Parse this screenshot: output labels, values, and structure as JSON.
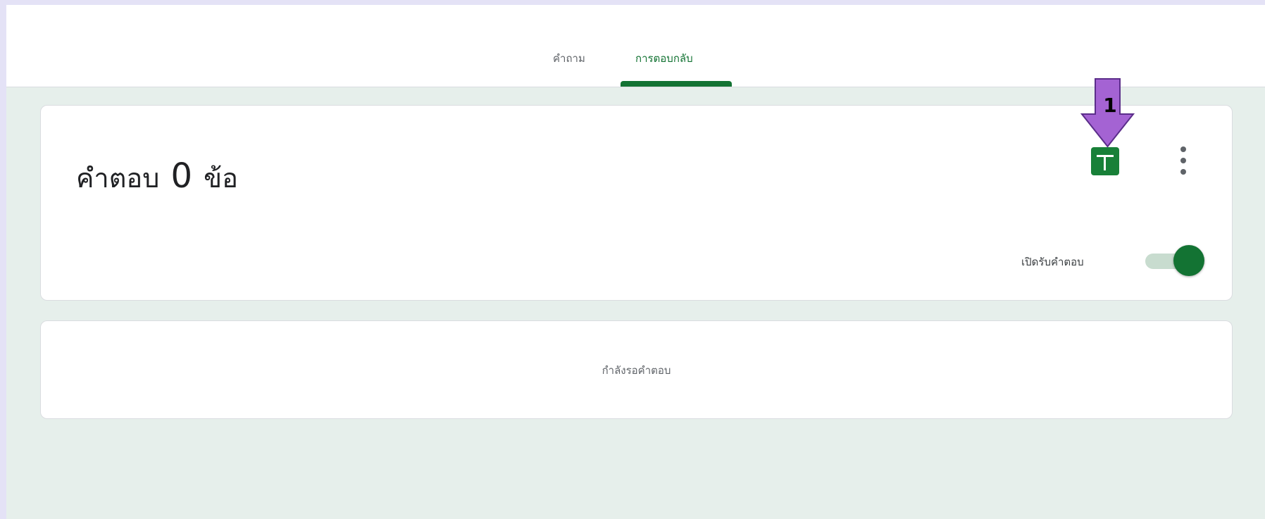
{
  "tabs": [
    {
      "label": "คำถาม",
      "active": false
    },
    {
      "label": "การตอบกลับ",
      "active": true
    }
  ],
  "summary": {
    "prefix": "คำตอบ",
    "count": "0",
    "suffix": "ข้อ",
    "sheets_icon": "google-sheets-icon",
    "more_icon": "more-vert-icon",
    "accepting_label": "เปิดรับคำตอบ",
    "accepting": true
  },
  "waiting": {
    "text": "กำลังรอคำตอบ"
  },
  "annotation": {
    "label": "1",
    "color": "#a463d3"
  },
  "colors": {
    "accent": "#137333",
    "sheets": "#188038",
    "background": "#e6efeb",
    "frame": "#e4e2f6"
  }
}
